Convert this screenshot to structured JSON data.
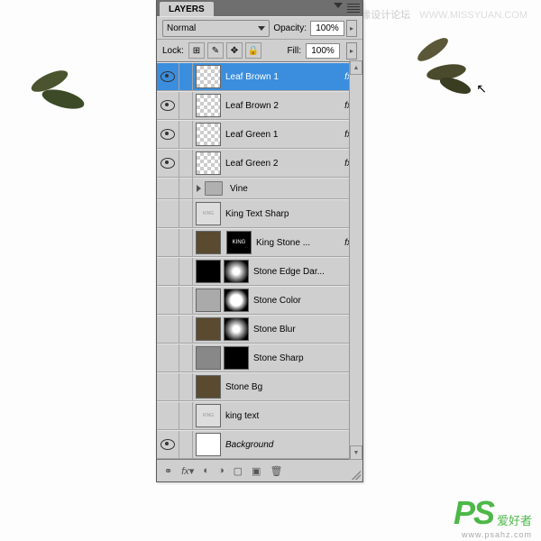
{
  "panel_title": "LAYERS",
  "blend_mode": "Normal",
  "opacity_label": "Opacity:",
  "opacity_value": "100%",
  "lock_label": "Lock:",
  "fill_label": "Fill:",
  "fill_value": "100%",
  "layers": [
    {
      "name": "Leaf Brown 1",
      "fx": true,
      "visible": true,
      "thumb": "checker"
    },
    {
      "name": "Leaf Brown 2",
      "fx": true,
      "visible": true,
      "thumb": "checker"
    },
    {
      "name": "Leaf Green 1",
      "fx": true,
      "visible": true,
      "thumb": "checker"
    },
    {
      "name": "Leaf Green 2",
      "fx": true,
      "visible": true,
      "thumb": "checker"
    },
    {
      "name": "Vine",
      "folder": true,
      "visible": false
    },
    {
      "name": "King Text Sharp",
      "visible": false,
      "thumb": "king"
    },
    {
      "name": "King Stone ...",
      "fx": true,
      "visible": false,
      "thumb": "texture",
      "extra": "king-stone"
    },
    {
      "name": "Stone Edge Dar...",
      "visible": false,
      "thumb": "black",
      "mask": "radial"
    },
    {
      "name": "Stone Color",
      "visible": false,
      "thumb": "pattern",
      "mask": "glow"
    },
    {
      "name": "Stone Blur",
      "visible": false,
      "thumb": "texture",
      "mask": "radial"
    },
    {
      "name": "Stone Sharp",
      "visible": false,
      "thumb": "grey",
      "mask": "black"
    },
    {
      "name": "Stone Bg",
      "visible": false,
      "thumb": "texture"
    },
    {
      "name": "king text",
      "visible": false,
      "thumb": "king"
    },
    {
      "name": "Background",
      "visible": true,
      "thumb": "white",
      "italic": true,
      "locked": true
    }
  ],
  "watermark_top_cn": "思缘设计论坛",
  "watermark_top_url": "WWW.MISSYUAN.COM",
  "watermark_ps": "PS",
  "watermark_ps_cn": "爱好者",
  "watermark_ps_url": "www.psahz.com"
}
